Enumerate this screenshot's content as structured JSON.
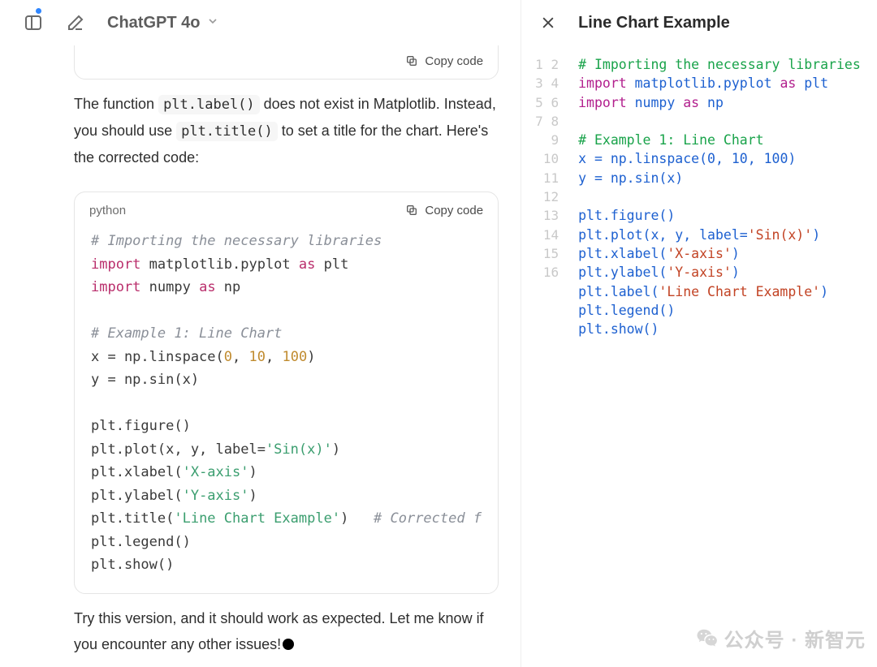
{
  "header": {
    "model_title": "ChatGPT 4o"
  },
  "chat": {
    "trunc_block": {
      "copy_label": "Copy code"
    },
    "explain_parts": {
      "a": "The function ",
      "b": "plt.label()",
      "c": " does not exist in Matplotlib. Instead, you should use ",
      "d": "plt.title()",
      "e": " to set a title for the chart. Here's the corrected code:"
    },
    "code2": {
      "lang": "python",
      "copy_label": "Copy code",
      "lines": {
        "l1": {
          "comment": "# Importing the necessary libraries"
        },
        "l2": {
          "kw1": "import",
          "mid": " matplotlib.pyplot ",
          "kw2": "as",
          "tail": " plt"
        },
        "l3": {
          "kw1": "import",
          "mid": " numpy ",
          "kw2": "as",
          "tail": " np"
        },
        "l4": {
          "blank": " "
        },
        "l5": {
          "comment": "# Example 1: Line Chart"
        },
        "l6": {
          "pre": "x = np.linspace(",
          "n1": "0",
          "c1": ", ",
          "n2": "10",
          "c2": ", ",
          "n3": "100",
          "post": ")"
        },
        "l7": {
          "text": "y = np.sin(x)"
        },
        "l8": {
          "blank": " "
        },
        "l9": {
          "text": "plt.figure()"
        },
        "l10": {
          "pre": "plt.plot(x, y, label=",
          "s": "'Sin(x)'",
          "post": ")"
        },
        "l11": {
          "pre": "plt.xlabel(",
          "s": "'X-axis'",
          "post": ")"
        },
        "l12": {
          "pre": "plt.ylabel(",
          "s": "'Y-axis'",
          "post": ")"
        },
        "l13": {
          "pre": "plt.title(",
          "s": "'Line Chart Example'",
          "post": ")   ",
          "comment": "# Corrected f"
        },
        "l14": {
          "text": "plt.legend()"
        },
        "l15": {
          "text": "plt.show()"
        }
      }
    },
    "outro": "Try this version, and it should work as expected. Let me know if you encounter any other issues!"
  },
  "canvas": {
    "title": "Line Chart Example",
    "line_count": 16,
    "lines": {
      "l1": {
        "comment": "# Importing the necessary libraries"
      },
      "l2": {
        "kw1": "import",
        "mid": " matplotlib.pyplot ",
        "kw2": "as",
        "tail": " plt"
      },
      "l3": {
        "kw1": "import",
        "mid": " numpy ",
        "kw2": "as",
        "tail": " np"
      },
      "l4": {
        "blank": " "
      },
      "l5": {
        "comment": "# Example 1: Line Chart"
      },
      "l6": {
        "pre": "x = np.linspace(",
        "n1": "0",
        "c1": ", ",
        "n2": "10",
        "c2": ", ",
        "n3": "100",
        "post": ")"
      },
      "l7": {
        "text": "y = np.sin(x)"
      },
      "l8": {
        "blank": " "
      },
      "l9": {
        "text": "plt.figure()"
      },
      "l10": {
        "pre": "plt.plot(x, y, label=",
        "s": "'Sin(x)'",
        "post": ")"
      },
      "l11": {
        "pre": "plt.xlabel(",
        "s": "'X-axis'",
        "post": ")"
      },
      "l12": {
        "pre": "plt.ylabel(",
        "s": "'Y-axis'",
        "post": ")"
      },
      "l13": {
        "pre": "plt.label(",
        "s": "'Line Chart Example'",
        "post": ")"
      },
      "l14": {
        "text": "plt.legend()"
      },
      "l15": {
        "text": "plt.show()"
      }
    }
  },
  "watermark": {
    "text": "公众号 · 新智元"
  }
}
